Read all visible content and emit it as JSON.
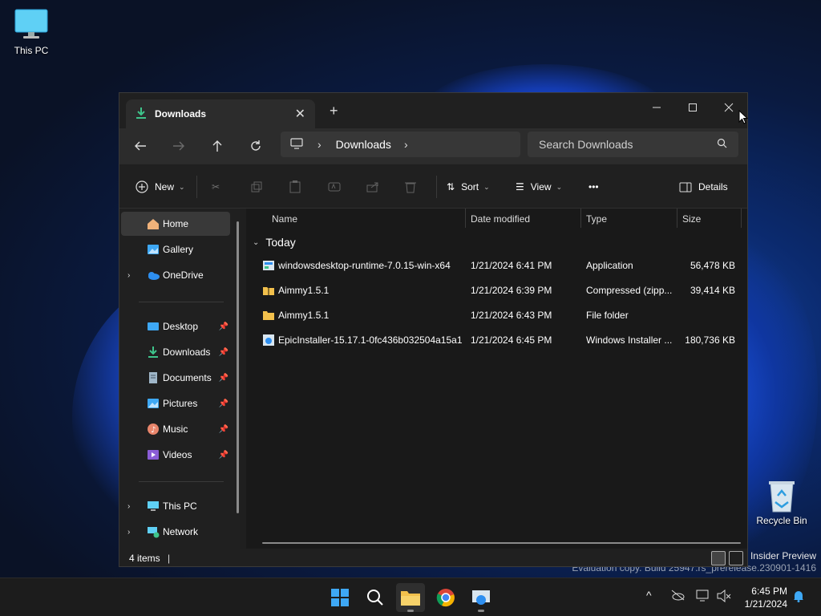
{
  "desktop": {
    "this_pc_label": "This PC",
    "recycle_bin_label": "Recycle Bin",
    "watermark_line1": "p Insider Preview",
    "watermark_line2": "Evaluation copy. Build 25947.rs_prerelease.230901-1416"
  },
  "window": {
    "tab_title": "Downloads",
    "address_crumb": "Downloads",
    "search_placeholder": "Search Downloads",
    "commands": {
      "new": "New",
      "sort": "Sort",
      "view": "View",
      "more": "•••",
      "details": "Details"
    },
    "sidebar": {
      "home": "Home",
      "gallery": "Gallery",
      "onedrive": "OneDrive",
      "desktop": "Desktop",
      "downloads": "Downloads",
      "documents": "Documents",
      "pictures": "Pictures",
      "music": "Music",
      "videos": "Videos",
      "this_pc": "This PC",
      "network": "Network"
    },
    "columns": {
      "name": "Name",
      "date": "Date modified",
      "type": "Type",
      "size": "Size"
    },
    "group_label": "Today",
    "files": [
      {
        "name": "windowsdesktop-runtime-7.0.15-win-x64",
        "date": "1/21/2024 6:41 PM",
        "type": "Application",
        "size": "56,478 KB",
        "icon": "installer-icon"
      },
      {
        "name": "Aimmy1.5.1",
        "date": "1/21/2024 6:39 PM",
        "type": "Compressed (zipp...",
        "size": "39,414 KB",
        "icon": "zip-folder-icon"
      },
      {
        "name": "Aimmy1.5.1",
        "date": "1/21/2024 6:43 PM",
        "type": "File folder",
        "size": "",
        "icon": "folder-icon"
      },
      {
        "name": "EpicInstaller-15.17.1-0fc436b032504a15a1...",
        "date": "1/21/2024 6:45 PM",
        "type": "Windows Installer ...",
        "size": "180,736 KB",
        "icon": "msi-icon"
      }
    ],
    "status": {
      "item_count": "4 items",
      "separator": "|"
    }
  },
  "taskbar": {
    "time": "6:45 PM",
    "date": "1/21/2024"
  },
  "colors": {
    "accent": "#4cc2ff",
    "folder": "#f2c04c",
    "window_bg": "#191919"
  }
}
